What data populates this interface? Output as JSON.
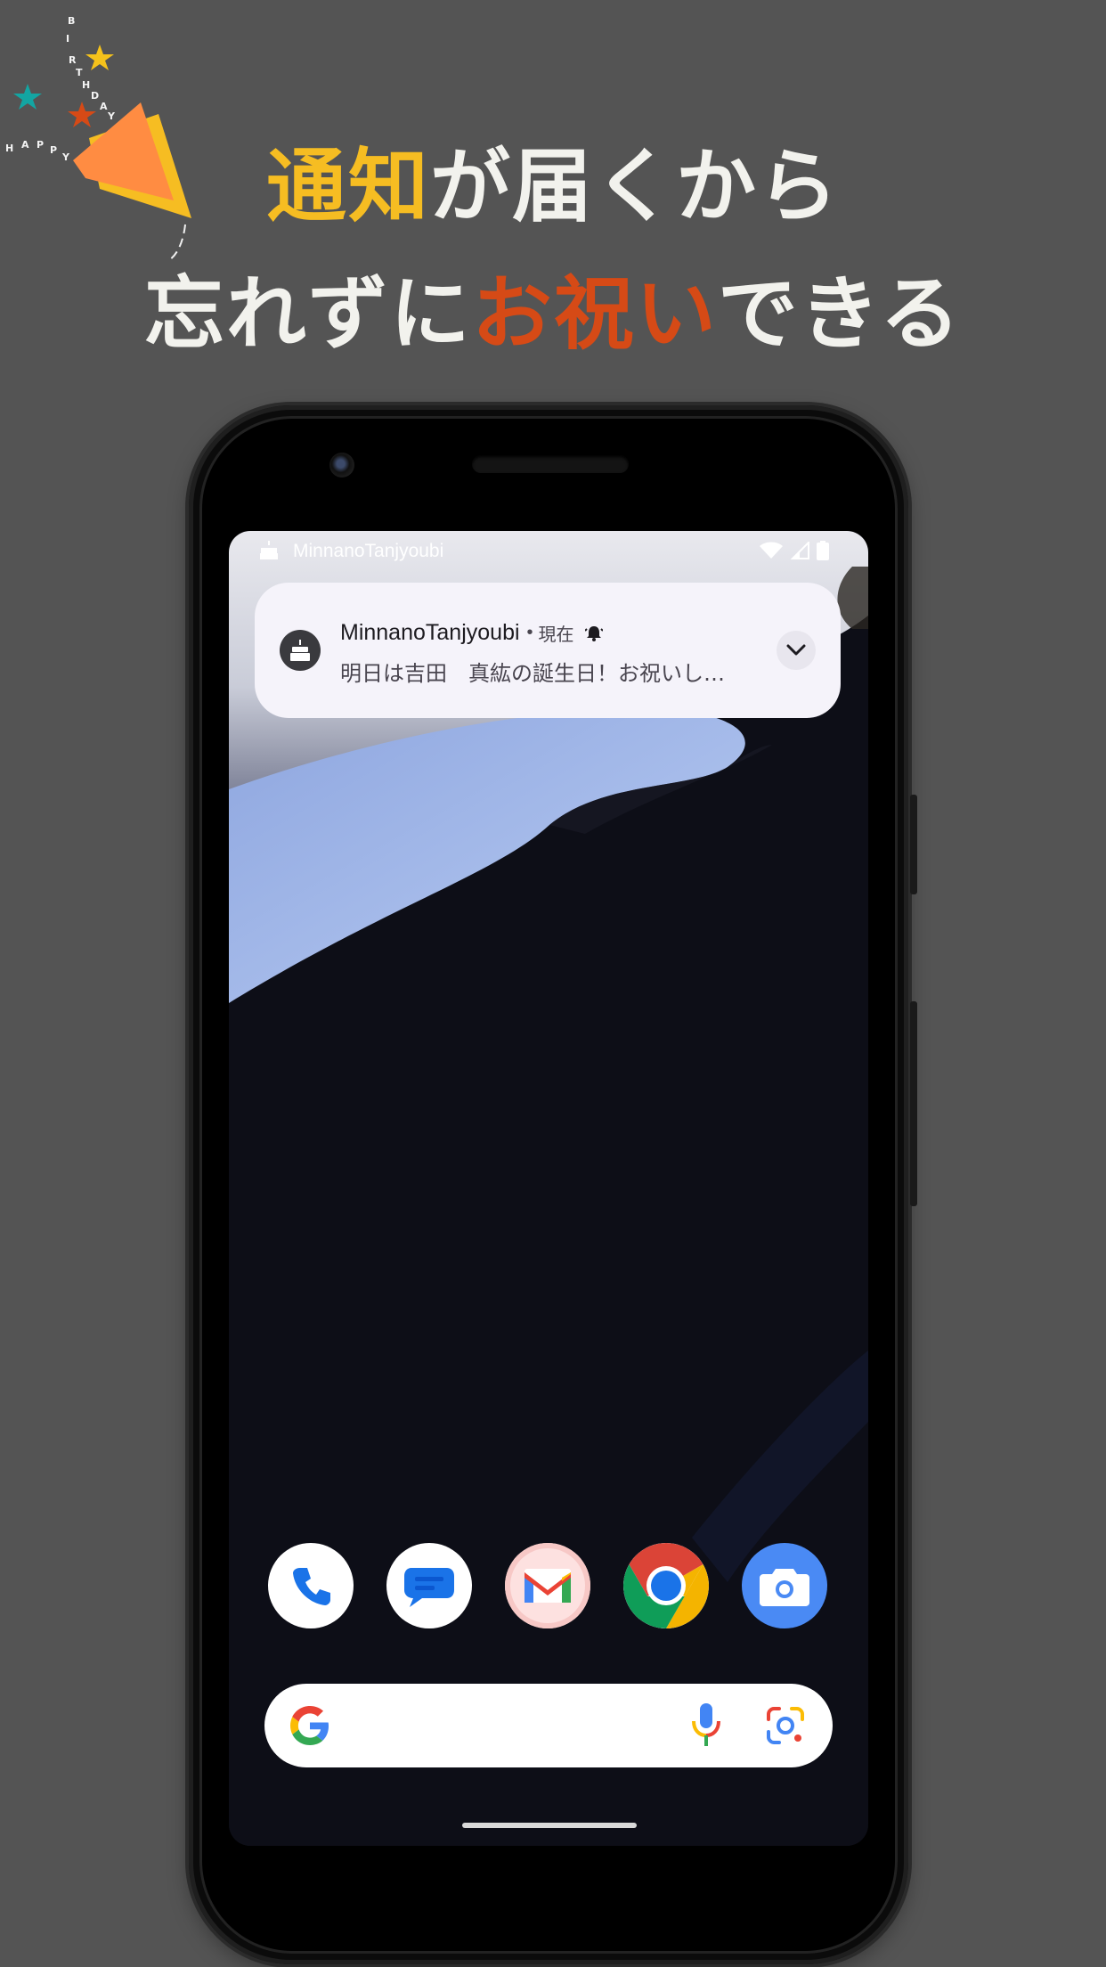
{
  "decoration": {
    "happy_letters": [
      "H",
      "A",
      "P",
      "P",
      "Y"
    ],
    "birthday_letters": [
      "B",
      "I",
      "R",
      "T",
      "H",
      "D",
      "A",
      "Y"
    ]
  },
  "headline": {
    "line1": [
      {
        "text": "通知",
        "color": "#f6bd22"
      },
      {
        "text": "が届くから",
        "color": "#f2f2ed"
      }
    ],
    "line2": [
      {
        "text": "忘れずに",
        "color": "#f2f2ed"
      },
      {
        "text": "お祝い",
        "color": "#d64a16"
      },
      {
        "text": "できる",
        "color": "#f2f2ed"
      }
    ]
  },
  "status_bar": {
    "app_name": "MinnanoTanjyoubi",
    "icons": [
      "cake-icon",
      "wifi-icon",
      "cellular-signal-icon",
      "battery-icon"
    ]
  },
  "notification": {
    "app_name": "MinnanoTanjyoubi",
    "separator": "•",
    "time": "現在",
    "message": "明日は吉田　真紘の誕生日！お祝いし…",
    "icons": [
      "cake-icon",
      "alert-bell-icon",
      "chevron-down-icon"
    ]
  },
  "dock": {
    "apps": [
      "phone-app-icon",
      "messages-app-icon",
      "gmail-app-icon",
      "chrome-app-icon",
      "camera-app-icon"
    ]
  },
  "search_bar": {
    "icons": [
      "google-logo-icon",
      "microphone-icon",
      "google-lens-icon"
    ]
  },
  "colors": {
    "background": "#545454",
    "accent_yellow": "#f6bd22",
    "accent_red": "#d64a16",
    "notification_bg": "#f5f3fa"
  }
}
